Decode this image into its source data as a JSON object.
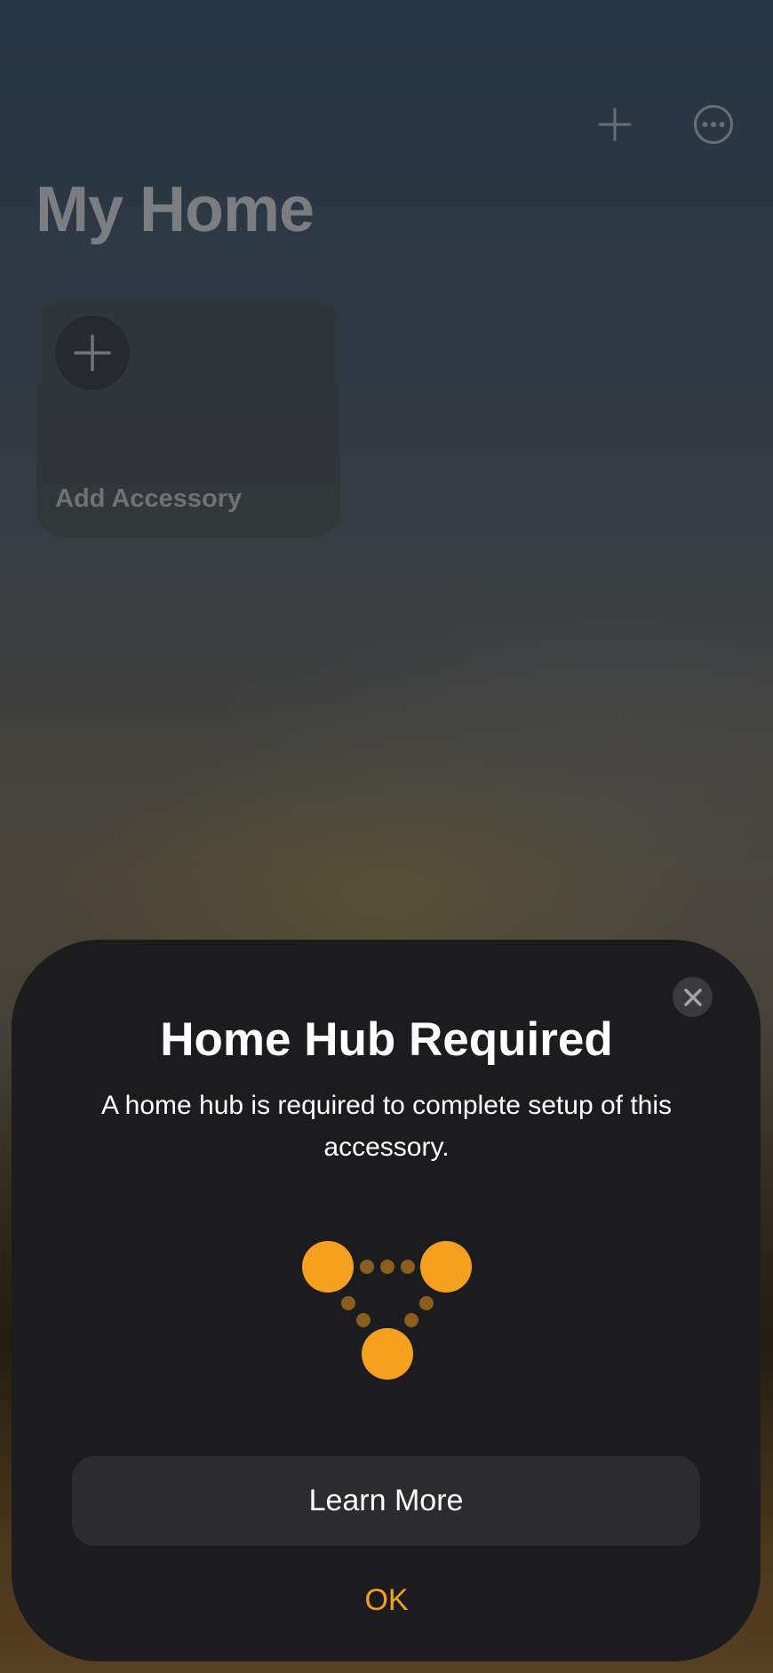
{
  "header": {
    "add_icon": "plus-icon",
    "more_icon": "ellipsis-circle-icon"
  },
  "home": {
    "title": "My Home",
    "tiles": [
      {
        "label": "Add Accessory",
        "icon": "plus-icon"
      }
    ]
  },
  "sheet": {
    "title": "Home Hub Required",
    "message": "A home hub is required to complete setup of this accessory.",
    "illustration_icon": "home-hub-network-icon",
    "close_icon": "close-icon",
    "learn_more_label": "Learn More",
    "ok_label": "OK"
  },
  "colors": {
    "accent": "#f5a01e",
    "sheet_background": "#1c1c1e",
    "secondary_button": "#2c2c2e"
  }
}
